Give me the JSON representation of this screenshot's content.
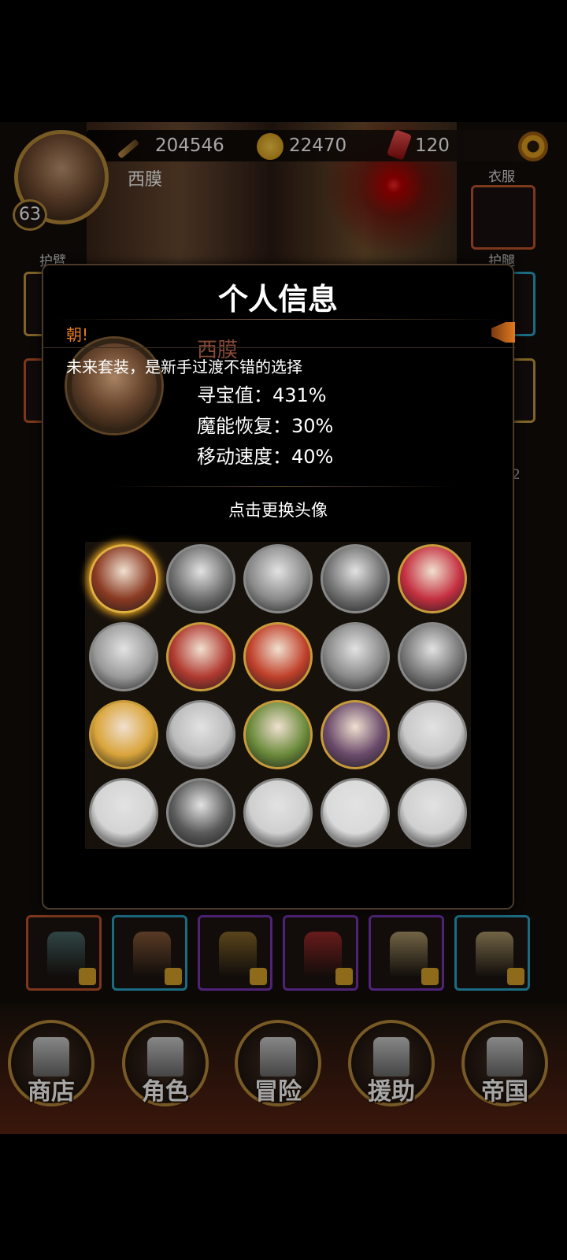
{
  "hud": {
    "power": "204546",
    "gold": "22470",
    "gems": "120",
    "player_name": "西膜",
    "level": "63"
  },
  "equip_labels": {
    "left_top": "护臂",
    "right_top": "衣服",
    "right_mid": "护腿",
    "right_count": "2"
  },
  "modal": {
    "title": "个人信息",
    "marquee_label": "朝!",
    "marquee_text": "未来套装，是新手过渡不错的选择",
    "profile_name": "西膜",
    "stats": [
      "寻宝值：431%",
      "魔能恢复：30%",
      "移动速度：40%"
    ],
    "change_hint": "点击更换头像"
  },
  "avatars": [
    {
      "icon": "male-hero-portrait-icon",
      "state": "selected",
      "color": "#8a3a22"
    },
    {
      "icon": "girl-portrait-icon",
      "state": "locked",
      "color": "#6d6d6d"
    },
    {
      "icon": "maid-portrait-icon",
      "state": "locked",
      "color": "#8a8a8a"
    },
    {
      "icon": "girl-portrait-icon",
      "state": "locked",
      "color": "#707070"
    },
    {
      "icon": "red-hair-girl-portrait-icon",
      "state": "unlocked",
      "color": "#c43040"
    },
    {
      "icon": "white-hair-girl-portrait-icon",
      "state": "locked",
      "color": "#9a9a9a"
    },
    {
      "icon": "red-hair-girl-portrait-icon",
      "state": "unlocked",
      "color": "#b03a30"
    },
    {
      "icon": "maid-portrait-icon",
      "state": "unlocked",
      "color": "#c0402a"
    },
    {
      "icon": "girl-portrait-icon",
      "state": "locked",
      "color": "#8a8a8a"
    },
    {
      "icon": "hooded-girl-portrait-icon",
      "state": "locked",
      "color": "#777777"
    },
    {
      "icon": "blonde-girl-portrait-icon",
      "state": "unlocked",
      "color": "#d9a43a"
    },
    {
      "icon": "hat-girl-portrait-icon",
      "state": "locked",
      "color": "#bcbcbc"
    },
    {
      "icon": "green-hood-girl-portrait-icon",
      "state": "unlocked",
      "color": "#6a8a3a"
    },
    {
      "icon": "dark-hair-girl-portrait-icon",
      "state": "unlocked",
      "color": "#6a4a6a"
    },
    {
      "icon": "white-hair-girl-portrait-icon",
      "state": "locked",
      "color": "#c8c8c8"
    },
    {
      "icon": "hat-girl-portrait-icon",
      "state": "locked",
      "color": "#d4d4d4"
    },
    {
      "icon": "hat-man-portrait-icon",
      "state": "locked",
      "color": "#5a5a5a"
    },
    {
      "icon": "girl-portrait-icon",
      "state": "locked",
      "color": "#cfcfcf"
    },
    {
      "icon": "girl-portrait-icon",
      "state": "locked",
      "color": "#dadada"
    },
    {
      "icon": "girl-portrait-icon",
      "state": "locked",
      "color": "#d0d0d0"
    }
  ],
  "equipment_slots": [
    {
      "icon": "helmet-icon",
      "rarity": "orange",
      "color": "#4a6a6a"
    },
    {
      "icon": "fur-cap-icon",
      "rarity": "blue",
      "color": "#8a5a3a"
    },
    {
      "icon": "gold-vest-icon",
      "rarity": "purple",
      "color": "#8a6a2a"
    },
    {
      "icon": "red-cape-armor-icon",
      "rarity": "purple",
      "color": "#a02a2a"
    },
    {
      "icon": "gold-armor-icon",
      "rarity": "purple",
      "color": "#b09a6a"
    },
    {
      "icon": "gold-armor-icon",
      "rarity": "blue",
      "color": "#b09a6a"
    }
  ],
  "nav": [
    {
      "label": "商店",
      "icon": "castle-icon"
    },
    {
      "label": "角色",
      "icon": "hooded-figure-icon"
    },
    {
      "label": "冒险",
      "icon": "dungeon-gate-icon"
    },
    {
      "label": "援助",
      "icon": "helper-girl-icon"
    },
    {
      "label": "帝国",
      "icon": "crown-icon"
    }
  ],
  "colors": {
    "gold_frame": "#b88a3a",
    "marquee_accent": "#e07a1f",
    "rarity_orange": "#c0552a",
    "rarity_blue": "#2aa6c9",
    "rarity_purple": "#7a36b8"
  }
}
